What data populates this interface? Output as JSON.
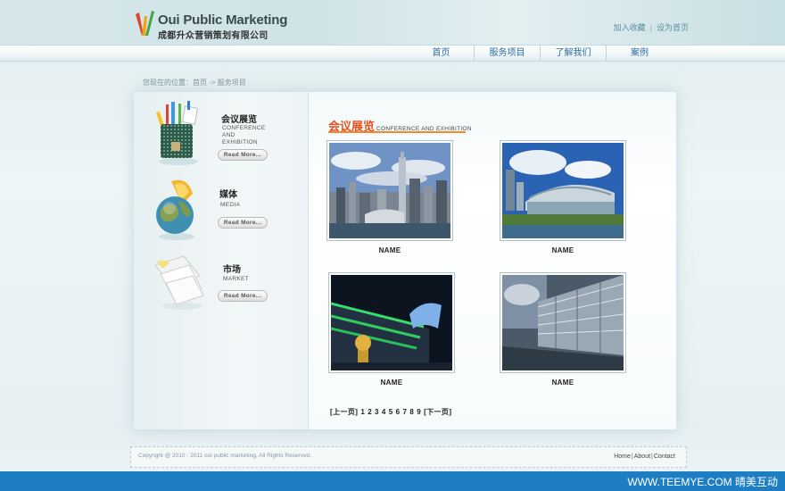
{
  "brand": {
    "name_en": "Oui Public Marketing",
    "name_cn": "成都升众营销策划有限公司",
    "colors": {
      "accent": "#e8501e",
      "nav_text": "#2d6ea0",
      "bar": "#1d7ec4"
    }
  },
  "top_links": {
    "favorite": "加入收藏",
    "separator": "|",
    "homepage": "设为首页"
  },
  "nav": {
    "items": [
      "首页",
      "服务项目",
      "了解我们",
      "案例"
    ]
  },
  "breadcrumb": "您现在的位置：首页 -> 服务项目",
  "sidebar": {
    "items": [
      {
        "title": "会议展览",
        "sub": [
          "CONFERENCE",
          "AND",
          "EXHIBITION"
        ],
        "button": "Read More...",
        "icon": "pencil-cup-icon"
      },
      {
        "title": "媒体",
        "sub": [
          "MEDIA"
        ],
        "button": "Read More...",
        "icon": "globe-icon"
      },
      {
        "title": "市场",
        "sub": [
          "MARKET"
        ],
        "button": "Read More...",
        "icon": "documents-icon"
      }
    ]
  },
  "content": {
    "title_cn": "会议展览",
    "title_en": "CONFERENCE AND EXHIBITION",
    "gallery": [
      {
        "name": "NAME",
        "scene": "city-skyline"
      },
      {
        "name": "NAME",
        "scene": "convention-center"
      },
      {
        "name": "NAME",
        "scene": "night-building"
      },
      {
        "name": "NAME",
        "scene": "glass-facade"
      }
    ],
    "pager": {
      "prev": "[上一页]",
      "pages": [
        "1",
        "2",
        "3",
        "4",
        "5",
        "6",
        "7",
        "8",
        "9"
      ],
      "next": "[下一页]"
    }
  },
  "footer": {
    "copyright": "Copyright @ 2010 - 2011 oui public marketing, All Rights Reserved.",
    "links": [
      "Home",
      "About",
      "Contact"
    ],
    "separator": "|"
  },
  "watermark": "WWW.TEEMYE.COM  晴美互动"
}
